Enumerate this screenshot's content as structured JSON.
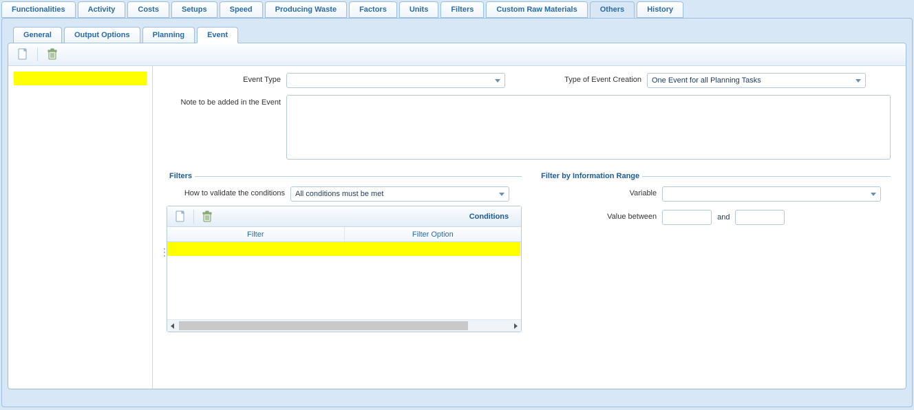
{
  "topTabs": [
    "Functionalities",
    "Activity",
    "Costs",
    "Setups",
    "Speed",
    "Producing Waste",
    "Factors",
    "Units",
    "Filters",
    "Custom Raw Materials",
    "Others",
    "History"
  ],
  "topTabActive": "Others",
  "subTabs": [
    "General",
    "Output Options",
    "Planning",
    "Event"
  ],
  "subTabActive": "Event",
  "form": {
    "eventTypeLabel": "Event Type",
    "eventTypeValue": "",
    "typeCreationLabel": "Type of Event Creation",
    "typeCreationValue": "One Event for all Planning Tasks",
    "noteLabel": "Note to be added in the Event",
    "noteValue": ""
  },
  "filters": {
    "legend": "Filters",
    "validateLabel": "How to validate the conditions",
    "validateValue": "All conditions must be met",
    "grid": {
      "title": "Conditions",
      "columns": [
        "Filter",
        "Filter Option"
      ]
    }
  },
  "filterRange": {
    "legend": "Filter by Information Range",
    "variableLabel": "Variable",
    "variableValue": "",
    "valueBetweenLabel": "Value between",
    "and": "and",
    "from": "",
    "to": ""
  }
}
